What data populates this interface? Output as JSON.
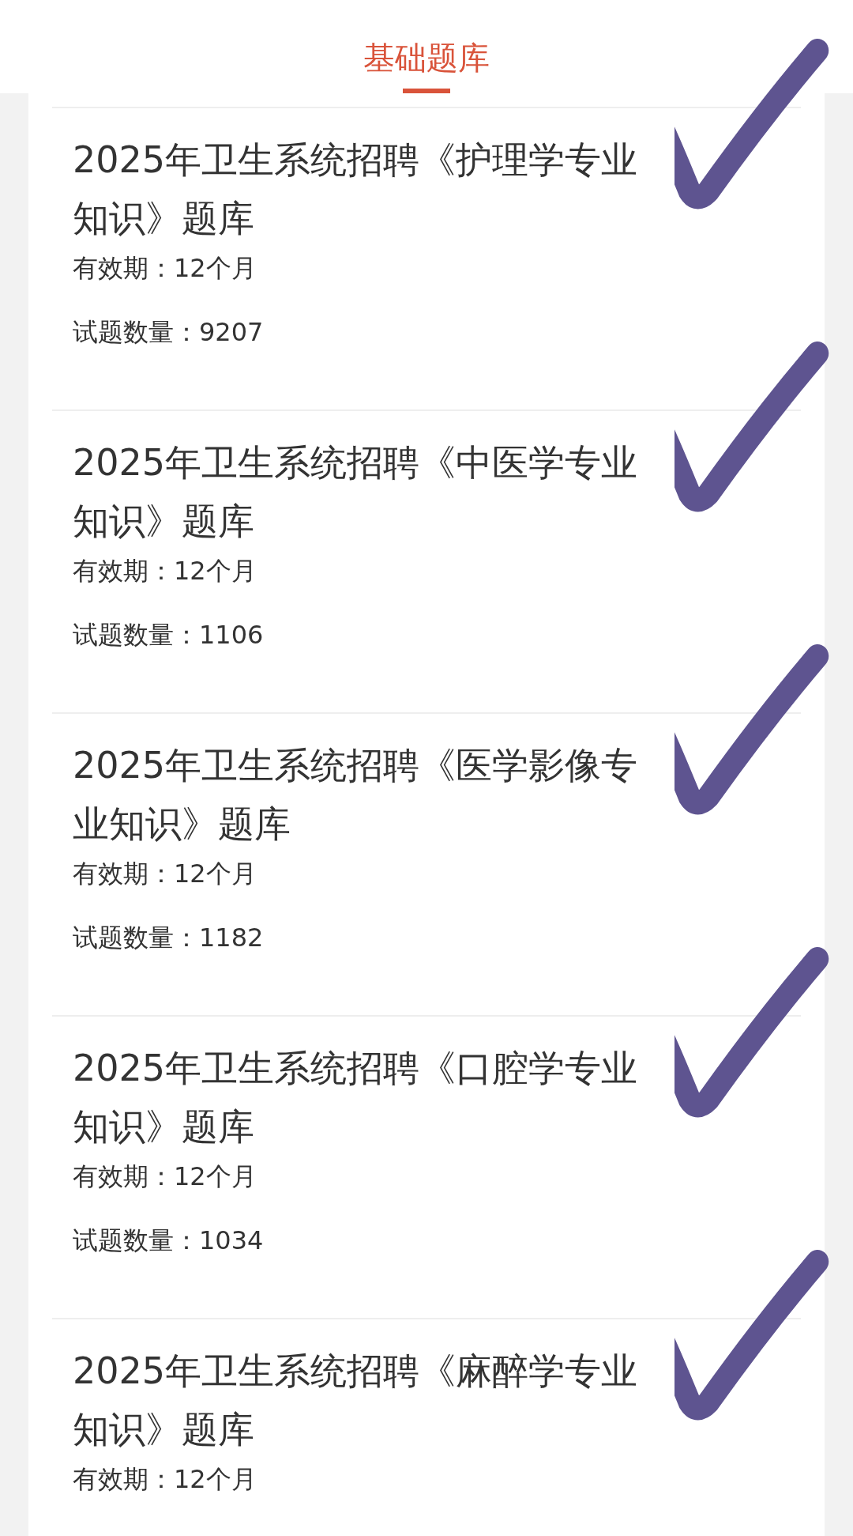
{
  "header": {
    "title": "基础题库"
  },
  "items": [
    {
      "title": "2025年卫生系统招聘《护理学专业知识》题库",
      "validity": "有效期：12个月",
      "count": "试题数量：9207",
      "checked": true
    },
    {
      "title": "2025年卫生系统招聘《中医学专业知识》题库",
      "validity": "有效期：12个月",
      "count": "试题数量：1106",
      "checked": true
    },
    {
      "title": "2025年卫生系统招聘《医学影像专业知识》题库",
      "validity": "有效期：12个月",
      "count": "试题数量：1182",
      "checked": true
    },
    {
      "title": "2025年卫生系统招聘《口腔学专业知识》题库",
      "validity": "有效期：12个月",
      "count": "试题数量：1034",
      "checked": true
    },
    {
      "title": "2025年卫生系统招聘《麻醉学专业知识》题库",
      "validity": "有效期：12个月",
      "checked": true
    }
  ]
}
